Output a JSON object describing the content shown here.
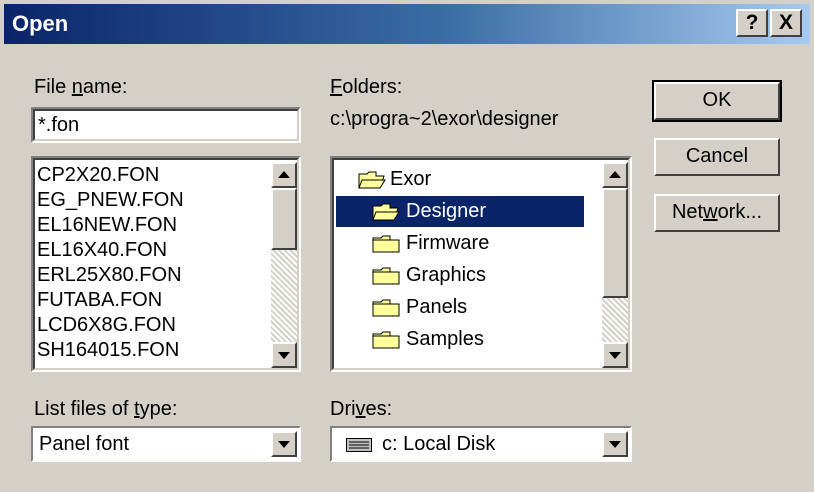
{
  "window": {
    "title": "Open",
    "help_button": "?",
    "close_button": "X"
  },
  "file_name": {
    "label_pre": "File ",
    "label_u": "n",
    "label_post": "ame:",
    "value": "*.fon",
    "files": [
      "CP2X20.FON",
      "EG_PNEW.FON",
      "EL16NEW.FON",
      "EL16X40.FON",
      "ERL25X80.FON",
      "FUTABA.FON",
      "LCD6X8G.FON",
      "SH164015.FON"
    ]
  },
  "folders": {
    "label_u": "F",
    "label_post": "olders:",
    "path": "c:\\progra~2\\exor\\designer",
    "items": [
      {
        "name": "Exor",
        "icon": "open-folder-icon",
        "selected": false
      },
      {
        "name": "Designer",
        "icon": "open-folder-icon",
        "selected": true
      },
      {
        "name": "Firmware",
        "icon": "folder-icon",
        "selected": false
      },
      {
        "name": "Graphics",
        "icon": "folder-icon",
        "selected": false
      },
      {
        "name": "Panels",
        "icon": "folder-icon",
        "selected": false
      },
      {
        "name": "Samples",
        "icon": "folder-icon",
        "selected": false
      }
    ]
  },
  "file_type": {
    "label_pre": "List files of ",
    "label_u": "t",
    "label_post": "ype:",
    "value": "Panel font"
  },
  "drives": {
    "label_pre": "Dri",
    "label_u": "v",
    "label_post": "es:",
    "value": "c: Local Disk"
  },
  "buttons": {
    "ok": "OK",
    "cancel": "Cancel",
    "network_pre": "Net",
    "network_u": "w",
    "network_post": "ork..."
  },
  "colors": {
    "title_start": "#0a246a",
    "title_end": "#a6caf0",
    "face": "#d4d0c8",
    "selection": "#0a246a",
    "folder": "#ffff9c"
  }
}
